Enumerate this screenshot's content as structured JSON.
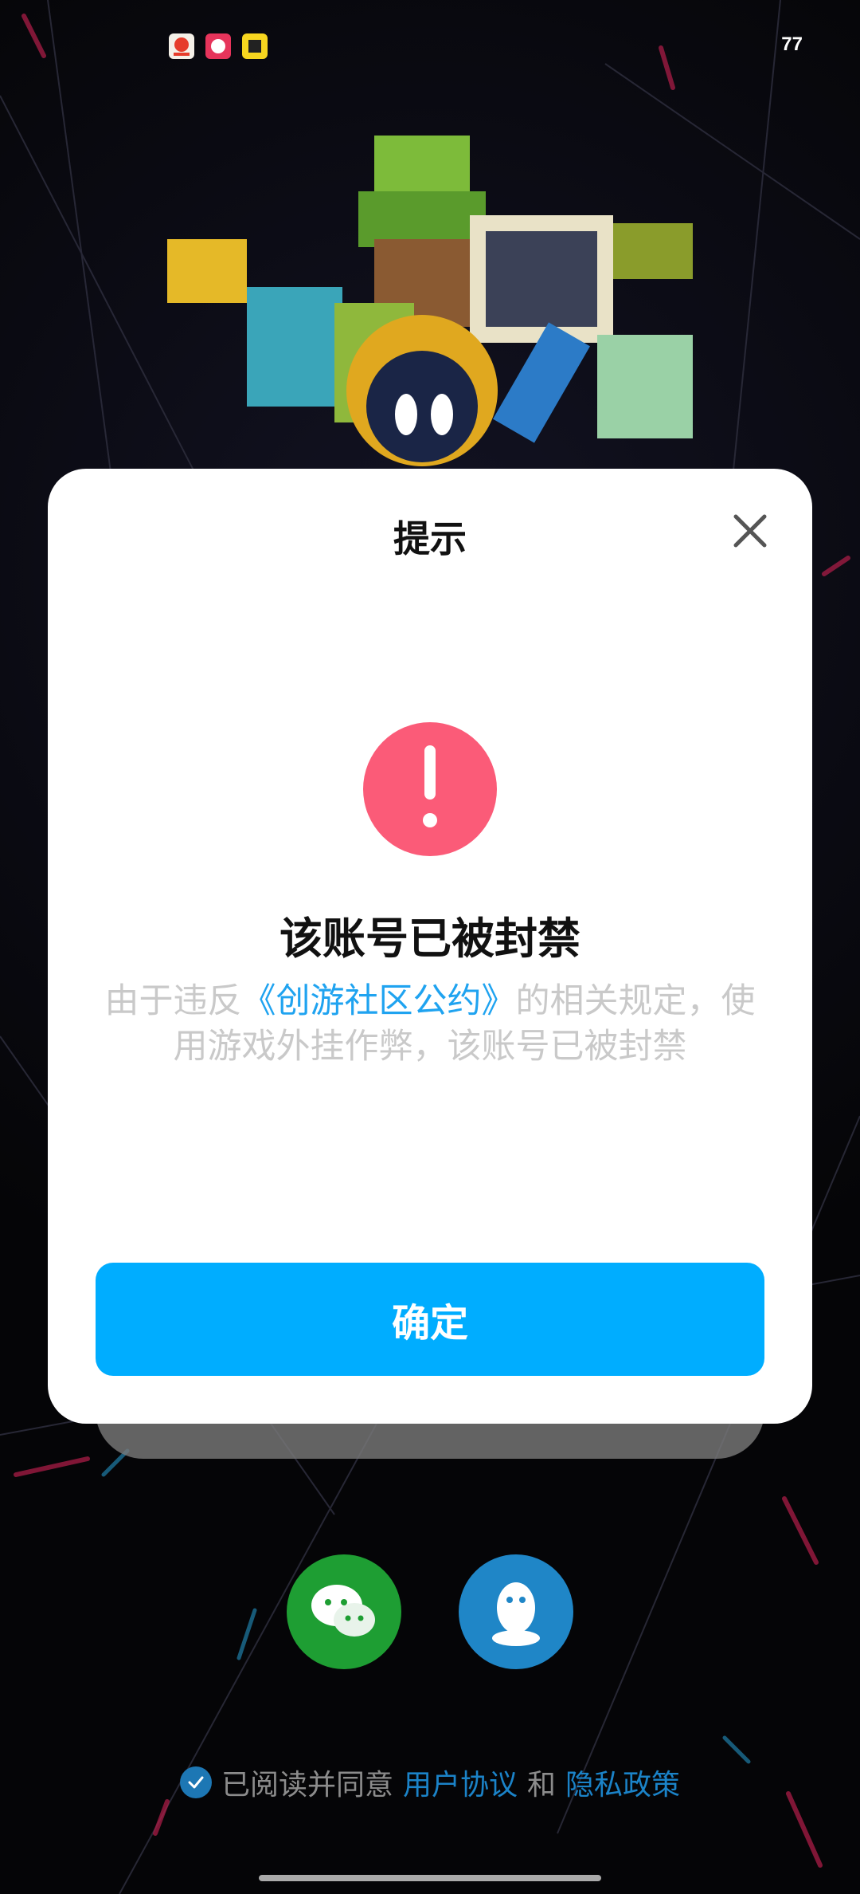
{
  "status_bar": {
    "battery": "77",
    "notification_icons": [
      "app-icon-1",
      "app-icon-2",
      "app-icon-3"
    ]
  },
  "dialog": {
    "title": "提示",
    "heading": "该账号已被封禁",
    "desc_before": "由于违反",
    "desc_link": "《创游社区公约》",
    "desc_after": "的相关规定，使用游戏外挂作弊，该账号已被封禁",
    "confirm_label": "确定",
    "alert_icon": "exclamation-icon",
    "accent_color": "#00adff",
    "alert_color": "#fb5b78"
  },
  "login": {
    "buttons": [
      "wechat-icon",
      "qq-icon"
    ]
  },
  "agreement": {
    "prefix": "已阅读并同意",
    "user_agreement": "用户协议",
    "and": "和",
    "privacy_policy": "隐私政策"
  }
}
